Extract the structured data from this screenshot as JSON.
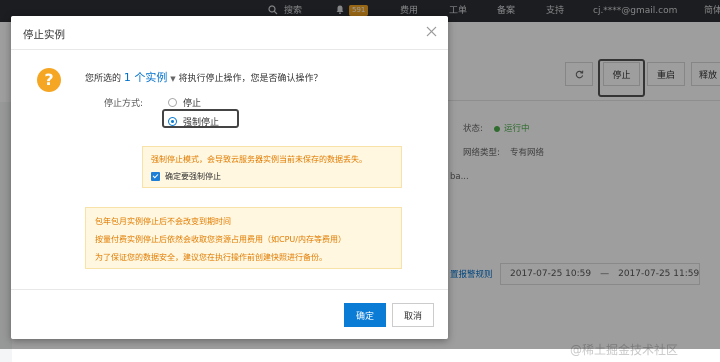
{
  "topnav": {
    "search": "搜索",
    "notification_count": "591",
    "items": [
      "费用",
      "工单",
      "备案",
      "支持"
    ],
    "account": "cj.****@gmail.com",
    "extra": "简体"
  },
  "background": {
    "toolbar": {
      "stop": "停止",
      "restart": "重启",
      "release": "释放"
    },
    "status_label": "状态:",
    "status_value": "运行中",
    "network_label": "网络类型:",
    "network_value": "专有网络",
    "partial_text": "ba...",
    "alarm_link": "置报警规则",
    "date_start": "2017-07-25 10:59",
    "date_sep": "—",
    "date_end": "2017-07-25 11:59",
    "watermark": "@稀土掘金技术社区"
  },
  "modal": {
    "title": "停止实例",
    "prompt_prefix": "您所选的",
    "instance_count": "1 个实例",
    "prompt_suffix": "将执行停止操作，您是否确认操作？",
    "stop_mode_label": "停止方式:",
    "options": [
      {
        "label": "停止",
        "checked": false
      },
      {
        "label": "强制停止",
        "checked": true
      }
    ],
    "force_warning": "强制停止模式，会导致云服务器实例当前未保存的数据丢失。",
    "confirm_force_label": "确定要强制停止",
    "notes": [
      "包年包月实例停止后不会改变到期时间",
      "按量付费实例停止后依然会收取您资源占用费用（如CPU/内存等费用）",
      "为了保证您的数据安全，建议您在执行操作前创建快照进行备份。"
    ],
    "confirm_button": "确定",
    "cancel_button": "取消"
  },
  "colors": {
    "accent": "#0a7cd6",
    "warning": "#e07b00",
    "warning_bg": "#fff7e0",
    "topnav_bg": "#2d3034"
  }
}
